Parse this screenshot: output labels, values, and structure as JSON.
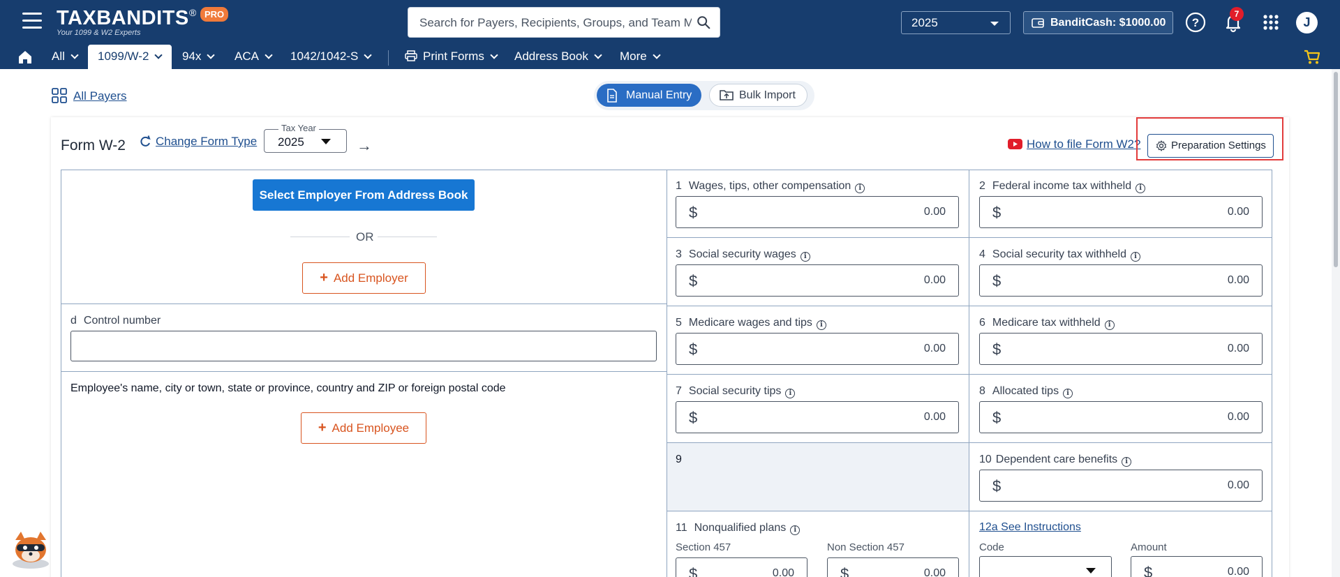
{
  "header": {
    "logo_text": "TAXBANDITS",
    "logo_registered": "®",
    "logo_badge": "PRO",
    "logo_tagline": "Your 1099 & W2 Experts",
    "search_placeholder": "Search for Payers, Recipients, Groups, and Team Members",
    "tax_year": "2025",
    "bandit_cash": "BanditCash: $1000.00",
    "notifications_count": "7",
    "user_initial": "J"
  },
  "nav": {
    "items": [
      {
        "label": "All",
        "dropdown": true
      },
      {
        "label": "1099/W-2",
        "dropdown": true,
        "active": true
      },
      {
        "label": "94x",
        "dropdown": true
      },
      {
        "label": "ACA",
        "dropdown": true
      },
      {
        "label": "1042/1042-S",
        "dropdown": true
      },
      {
        "label": "Print Forms",
        "dropdown": true
      },
      {
        "label": "Address Book",
        "dropdown": true
      },
      {
        "label": "More",
        "dropdown": true
      }
    ]
  },
  "subheader": {
    "all_payers": "All Payers",
    "manual_entry": "Manual Entry",
    "bulk_import": "Bulk Import"
  },
  "form": {
    "title": "Form W-2",
    "change_form_type": "Change Form Type",
    "tax_year_label": "Tax Year",
    "tax_year_value": "2025",
    "how_to": "How to file Form W2?",
    "prep_settings": "Preparation Settings",
    "select_employer": "Select Employer From Address Book",
    "or_text": "OR",
    "add_employer": "Add Employer",
    "control_number_letter": "d",
    "control_number_label": "Control number",
    "control_number_value": "",
    "employee_label": "Employee's name, city or town, state or province, country and ZIP or foreign postal code",
    "add_employee": "Add Employee",
    "boxes": [
      {
        "num": "1",
        "label": "Wages, tips, other compensation",
        "value": "0.00"
      },
      {
        "num": "2",
        "label": "Federal income tax withheld",
        "value": "0.00"
      },
      {
        "num": "3",
        "label": "Social security wages",
        "value": "0.00"
      },
      {
        "num": "4",
        "label": "Social security tax withheld",
        "value": "0.00"
      },
      {
        "num": "5",
        "label": "Medicare wages and tips",
        "value": "0.00"
      },
      {
        "num": "6",
        "label": "Medicare tax withheld",
        "value": "0.00"
      },
      {
        "num": "7",
        "label": "Social security tips",
        "value": "0.00"
      },
      {
        "num": "8",
        "label": "Allocated tips",
        "value": "0.00"
      },
      {
        "num": "9",
        "label": ""
      },
      {
        "num": "10",
        "label": "Dependent care benefits",
        "value": "0.00"
      }
    ],
    "box11": {
      "num": "11",
      "label": "Nonqualified plans",
      "section_457": "Section 457",
      "section_457_value": "0.00",
      "non_section_457": "Non Section 457",
      "non_section_457_value": "0.00"
    },
    "box12a": {
      "label": "12a See Instructions",
      "code_label": "Code",
      "code_value": "",
      "amount_label": "Amount",
      "amount_value": "0.00"
    },
    "currency_symbol": "$"
  },
  "colors": {
    "header_bg": "#173d6e",
    "primary_button": "#1777d3",
    "accent_orange": "#d8541f",
    "highlight_red": "#e23b3b",
    "link": "#1f4f8f"
  }
}
